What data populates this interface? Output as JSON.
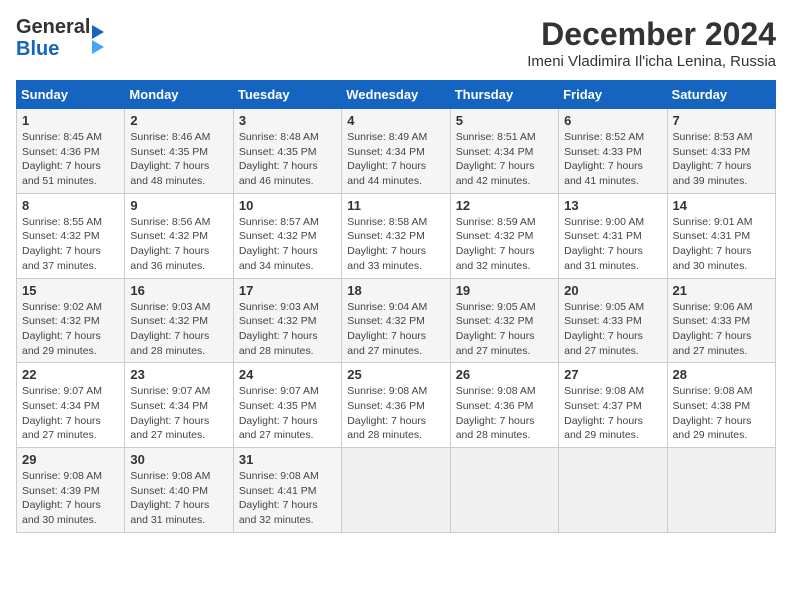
{
  "header": {
    "logo_line1": "General",
    "logo_line2": "Blue",
    "month_title": "December 2024",
    "location": "Imeni Vladimira Il'icha Lenina, Russia"
  },
  "weekdays": [
    "Sunday",
    "Monday",
    "Tuesday",
    "Wednesday",
    "Thursday",
    "Friday",
    "Saturday"
  ],
  "weeks": [
    [
      {
        "day": "1",
        "sunrise": "8:45 AM",
        "sunset": "4:36 PM",
        "daylight": "7 hours and 51 minutes."
      },
      {
        "day": "2",
        "sunrise": "8:46 AM",
        "sunset": "4:35 PM",
        "daylight": "7 hours and 48 minutes."
      },
      {
        "day": "3",
        "sunrise": "8:48 AM",
        "sunset": "4:35 PM",
        "daylight": "7 hours and 46 minutes."
      },
      {
        "day": "4",
        "sunrise": "8:49 AM",
        "sunset": "4:34 PM",
        "daylight": "7 hours and 44 minutes."
      },
      {
        "day": "5",
        "sunrise": "8:51 AM",
        "sunset": "4:34 PM",
        "daylight": "7 hours and 42 minutes."
      },
      {
        "day": "6",
        "sunrise": "8:52 AM",
        "sunset": "4:33 PM",
        "daylight": "7 hours and 41 minutes."
      },
      {
        "day": "7",
        "sunrise": "8:53 AM",
        "sunset": "4:33 PM",
        "daylight": "7 hours and 39 minutes."
      }
    ],
    [
      {
        "day": "8",
        "sunrise": "8:55 AM",
        "sunset": "4:32 PM",
        "daylight": "7 hours and 37 minutes."
      },
      {
        "day": "9",
        "sunrise": "8:56 AM",
        "sunset": "4:32 PM",
        "daylight": "7 hours and 36 minutes."
      },
      {
        "day": "10",
        "sunrise": "8:57 AM",
        "sunset": "4:32 PM",
        "daylight": "7 hours and 34 minutes."
      },
      {
        "day": "11",
        "sunrise": "8:58 AM",
        "sunset": "4:32 PM",
        "daylight": "7 hours and 33 minutes."
      },
      {
        "day": "12",
        "sunrise": "8:59 AM",
        "sunset": "4:32 PM",
        "daylight": "7 hours and 32 minutes."
      },
      {
        "day": "13",
        "sunrise": "9:00 AM",
        "sunset": "4:31 PM",
        "daylight": "7 hours and 31 minutes."
      },
      {
        "day": "14",
        "sunrise": "9:01 AM",
        "sunset": "4:31 PM",
        "daylight": "7 hours and 30 minutes."
      }
    ],
    [
      {
        "day": "15",
        "sunrise": "9:02 AM",
        "sunset": "4:32 PM",
        "daylight": "7 hours and 29 minutes."
      },
      {
        "day": "16",
        "sunrise": "9:03 AM",
        "sunset": "4:32 PM",
        "daylight": "7 hours and 28 minutes."
      },
      {
        "day": "17",
        "sunrise": "9:03 AM",
        "sunset": "4:32 PM",
        "daylight": "7 hours and 28 minutes."
      },
      {
        "day": "18",
        "sunrise": "9:04 AM",
        "sunset": "4:32 PM",
        "daylight": "7 hours and 27 minutes."
      },
      {
        "day": "19",
        "sunrise": "9:05 AM",
        "sunset": "4:32 PM",
        "daylight": "7 hours and 27 minutes."
      },
      {
        "day": "20",
        "sunrise": "9:05 AM",
        "sunset": "4:33 PM",
        "daylight": "7 hours and 27 minutes."
      },
      {
        "day": "21",
        "sunrise": "9:06 AM",
        "sunset": "4:33 PM",
        "daylight": "7 hours and 27 minutes."
      }
    ],
    [
      {
        "day": "22",
        "sunrise": "9:07 AM",
        "sunset": "4:34 PM",
        "daylight": "7 hours and 27 minutes."
      },
      {
        "day": "23",
        "sunrise": "9:07 AM",
        "sunset": "4:34 PM",
        "daylight": "7 hours and 27 minutes."
      },
      {
        "day": "24",
        "sunrise": "9:07 AM",
        "sunset": "4:35 PM",
        "daylight": "7 hours and 27 minutes."
      },
      {
        "day": "25",
        "sunrise": "9:08 AM",
        "sunset": "4:36 PM",
        "daylight": "7 hours and 28 minutes."
      },
      {
        "day": "26",
        "sunrise": "9:08 AM",
        "sunset": "4:36 PM",
        "daylight": "7 hours and 28 minutes."
      },
      {
        "day": "27",
        "sunrise": "9:08 AM",
        "sunset": "4:37 PM",
        "daylight": "7 hours and 29 minutes."
      },
      {
        "day": "28",
        "sunrise": "9:08 AM",
        "sunset": "4:38 PM",
        "daylight": "7 hours and 29 minutes."
      }
    ],
    [
      {
        "day": "29",
        "sunrise": "9:08 AM",
        "sunset": "4:39 PM",
        "daylight": "7 hours and 30 minutes."
      },
      {
        "day": "30",
        "sunrise": "9:08 AM",
        "sunset": "4:40 PM",
        "daylight": "7 hours and 31 minutes."
      },
      {
        "day": "31",
        "sunrise": "9:08 AM",
        "sunset": "4:41 PM",
        "daylight": "7 hours and 32 minutes."
      },
      null,
      null,
      null,
      null
    ]
  ]
}
